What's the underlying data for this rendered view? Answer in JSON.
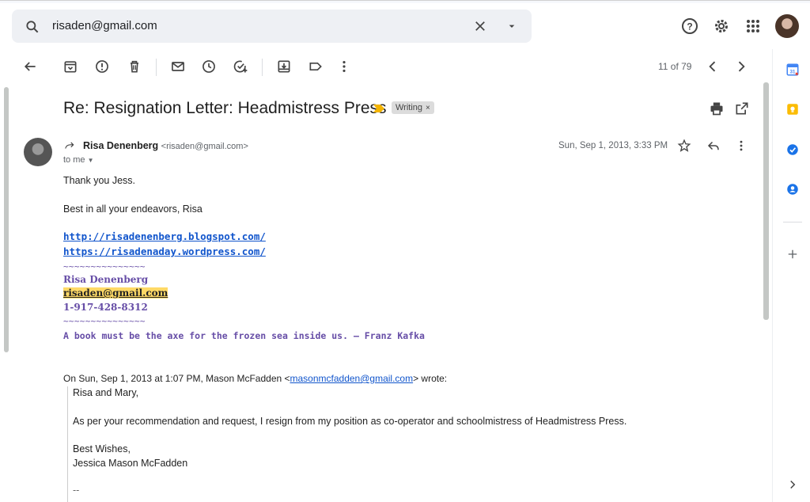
{
  "search": {
    "value": "risaden@gmail.com"
  },
  "toolbar": {
    "counter": "11 of 79"
  },
  "message": {
    "subject": "Re: Resignation Letter: Headmistress Press",
    "label": "Writing",
    "label_close": "×",
    "sender_name": "Risa Denenberg",
    "sender_email": "<risaden@gmail.com>",
    "to": "to me",
    "date": "Sun, Sep 1, 2013, 3:33 PM",
    "body_line1": "Thank you Jess.",
    "body_line2": "Best in all your endeavors, Risa",
    "link1": "http://risadenenberg.blogspot.com/",
    "link2": "https://risadenaday.wordpress.com/",
    "tilde": "~~~~~~~~~~~~~~~",
    "sig_name": "Risa Denenberg",
    "sig_email": "risaden@gmail.com",
    "sig_phone": "1-917-428-8312",
    "sig_quote": "A book must be the axe for the frozen sea inside us.  — Franz Kafka",
    "quote_header_pre": "On Sun, Sep 1, 2013 at 1:07 PM, Mason McFadden <",
    "quote_header_email": "masonmcfadden@gmail.com",
    "quote_header_post": "> wrote:",
    "quote_greeting": "Risa and Mary,",
    "quote_body": "As per your recommendation and request, I resign from my position as co-operator and schoolmistress of Headmistress Press.",
    "quote_closing": "Best Wishes,",
    "quote_name": "Jessica Mason McFadden",
    "quote_dash": "--"
  },
  "colors": {
    "link": "#1155cc",
    "signature": "#674ea7",
    "highlight": "#ffd966"
  }
}
